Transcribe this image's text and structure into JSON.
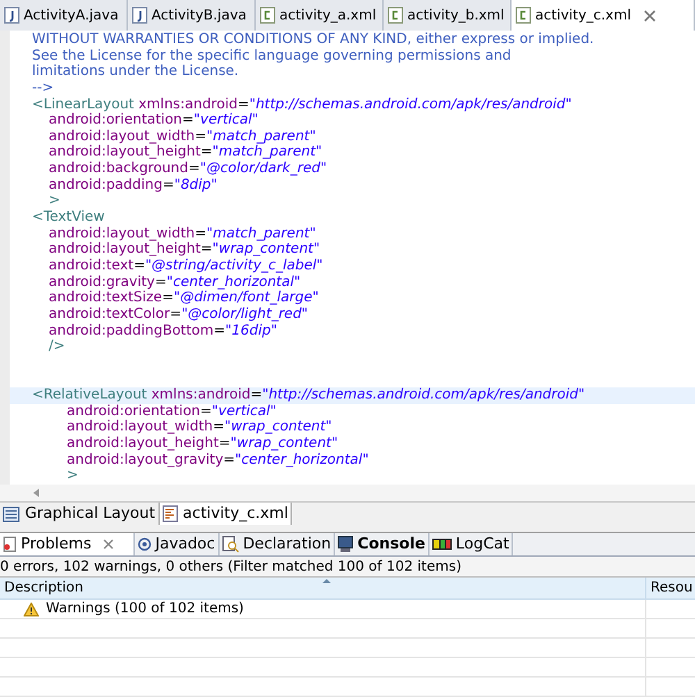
{
  "editor_tabs": [
    {
      "label": "ActivityA.java",
      "kind": "java",
      "selected": false
    },
    {
      "label": "ActivityB.java",
      "kind": "java",
      "selected": false
    },
    {
      "label": "activity_a.xml",
      "kind": "xml",
      "selected": false
    },
    {
      "label": "activity_b.xml",
      "kind": "xml",
      "selected": false
    },
    {
      "label": "activity_c.xml",
      "kind": "xml",
      "selected": true
    }
  ],
  "code_lines": [
    {
      "kind": "top",
      "current": false,
      "parts": [
        {
          "kind": "comment",
          "text": "WITHOUT WARRANTIES OR CONDITIONS OF ANY KIND, either express or implied."
        }
      ]
    },
    {
      "kind": "top",
      "current": false,
      "parts": [
        {
          "kind": "comment",
          "text": "See the License for the specific language governing permissions and"
        }
      ]
    },
    {
      "kind": "top",
      "current": false,
      "parts": [
        {
          "kind": "comment",
          "text": "limitations under the License."
        }
      ]
    },
    {
      "kind": "top",
      "current": false,
      "parts": [
        {
          "kind": "comment",
          "text": "-->"
        }
      ]
    },
    {
      "kind": "top",
      "current": false,
      "parts": [
        {
          "kind": "tag",
          "text": "<LinearLayout"
        },
        {
          "kind": "attr",
          "text": "xmlns:android"
        },
        {
          "kind": "punct",
          "text": "="
        },
        {
          "kind": "value",
          "text": "\"http://schemas.android.com/apk/res/android\""
        }
      ]
    },
    {
      "kind": "attribute",
      "current": false,
      "parts": [
        {
          "kind": "attr",
          "text": "android:orientation"
        },
        {
          "kind": "punct",
          "text": "="
        },
        {
          "kind": "value",
          "text": "\"vertical\""
        }
      ]
    },
    {
      "kind": "attribute",
      "current": false,
      "parts": [
        {
          "kind": "attr",
          "text": "android:layout_width"
        },
        {
          "kind": "punct",
          "text": "="
        },
        {
          "kind": "value",
          "text": "\"match_parent\""
        }
      ]
    },
    {
      "kind": "attribute",
      "current": false,
      "parts": [
        {
          "kind": "attr",
          "text": "android:layout_height"
        },
        {
          "kind": "punct",
          "text": "="
        },
        {
          "kind": "value",
          "text": "\"match_parent\""
        }
      ]
    },
    {
      "kind": "attribute",
      "current": false,
      "parts": [
        {
          "kind": "attr",
          "text": "android:background"
        },
        {
          "kind": "punct",
          "text": "="
        },
        {
          "kind": "value",
          "text": "\"@color/dark_red\""
        }
      ]
    },
    {
      "kind": "attribute",
      "current": false,
      "parts": [
        {
          "kind": "attr",
          "text": "android:padding"
        },
        {
          "kind": "punct",
          "text": "="
        },
        {
          "kind": "value",
          "text": "\"8dip\""
        }
      ]
    },
    {
      "kind": "attribute",
      "current": false,
      "parts": [
        {
          "kind": "tag",
          "text": ">"
        }
      ]
    },
    {
      "kind": "top",
      "current": false,
      "parts": [
        {
          "kind": "tag",
          "text": "<TextView"
        }
      ]
    },
    {
      "kind": "attribute",
      "current": false,
      "parts": [
        {
          "kind": "attr",
          "text": "android:layout_width"
        },
        {
          "kind": "punct",
          "text": "="
        },
        {
          "kind": "value",
          "text": "\"match_parent\""
        }
      ]
    },
    {
      "kind": "attribute",
      "current": false,
      "parts": [
        {
          "kind": "attr",
          "text": "android:layout_height"
        },
        {
          "kind": "punct",
          "text": "="
        },
        {
          "kind": "value",
          "text": "\"wrap_content\""
        }
      ]
    },
    {
      "kind": "attribute",
      "current": false,
      "parts": [
        {
          "kind": "attr",
          "text": "android:text"
        },
        {
          "kind": "punct",
          "text": "="
        },
        {
          "kind": "value",
          "text": "\"@string/activity_c_label\""
        }
      ]
    },
    {
      "kind": "attribute",
      "current": false,
      "parts": [
        {
          "kind": "attr",
          "text": "android:gravity"
        },
        {
          "kind": "punct",
          "text": "="
        },
        {
          "kind": "value",
          "text": "\"center_horizontal\""
        }
      ]
    },
    {
      "kind": "attribute",
      "current": false,
      "parts": [
        {
          "kind": "attr",
          "text": "android:textSize"
        },
        {
          "kind": "punct",
          "text": "="
        },
        {
          "kind": "value",
          "text": "\"@dimen/font_large\""
        }
      ]
    },
    {
      "kind": "attribute",
      "current": false,
      "parts": [
        {
          "kind": "attr",
          "text": "android:textColor"
        },
        {
          "kind": "punct",
          "text": "="
        },
        {
          "kind": "value",
          "text": "\"@color/light_red\""
        }
      ]
    },
    {
      "kind": "attribute",
      "current": false,
      "parts": [
        {
          "kind": "attr",
          "text": "android:paddingBottom"
        },
        {
          "kind": "punct",
          "text": "="
        },
        {
          "kind": "value",
          "text": "\"16dip\""
        }
      ]
    },
    {
      "kind": "attribute",
      "current": false,
      "parts": [
        {
          "kind": "tag",
          "text": "/>"
        }
      ]
    },
    {
      "kind": "blank",
      "current": false
    },
    {
      "kind": "blank",
      "current": false
    },
    {
      "kind": "top",
      "current": true,
      "parts": [
        {
          "kind": "tag",
          "text": "<RelativeLayout"
        },
        {
          "kind": "attr",
          "text": "xmlns:android"
        },
        {
          "kind": "punct",
          "text": "="
        },
        {
          "kind": "value",
          "text": "\"http://schemas.android.com/apk/res/android\""
        }
      ]
    },
    {
      "kind": "nested",
      "current": false,
      "parts": [
        {
          "kind": "attr",
          "text": "android:orientation"
        },
        {
          "kind": "punct",
          "text": "="
        },
        {
          "kind": "value",
          "text": "\"vertical\""
        }
      ]
    },
    {
      "kind": "nested",
      "current": false,
      "parts": [
        {
          "kind": "attr",
          "text": "android:layout_width"
        },
        {
          "kind": "punct",
          "text": "="
        },
        {
          "kind": "value",
          "text": "\"wrap_content\""
        }
      ]
    },
    {
      "kind": "nested",
      "current": false,
      "parts": [
        {
          "kind": "attr",
          "text": "android:layout_height"
        },
        {
          "kind": "punct",
          "text": "="
        },
        {
          "kind": "value",
          "text": "\"wrap_content\""
        }
      ]
    },
    {
      "kind": "nested",
      "current": false,
      "parts": [
        {
          "kind": "attr",
          "text": "android:layout_gravity"
        },
        {
          "kind": "punct",
          "text": "="
        },
        {
          "kind": "value",
          "text": "\"center_horizontal\""
        }
      ]
    },
    {
      "kind": "nested",
      "current": false,
      "parts": [
        {
          "kind": "tag",
          "text": ">"
        }
      ]
    }
  ],
  "editor_mode_tabs": [
    {
      "label": "Graphical Layout",
      "kind": "layout",
      "selected": false
    },
    {
      "label": "activity_c.xml",
      "kind": "source",
      "selected": true
    }
  ],
  "view_tabs": [
    {
      "label": "Problems",
      "kind": "problems",
      "selected": true
    },
    {
      "label": "Javadoc",
      "kind": "javadoc",
      "selected": false
    },
    {
      "label": "Declaration",
      "kind": "declaration",
      "selected": false
    },
    {
      "label": "Console",
      "kind": "console",
      "selected": false
    },
    {
      "label": "LogCat",
      "kind": "logcat",
      "selected": false
    }
  ],
  "problems": {
    "summary": "0 errors, 102 warnings, 0 others (Filter matched 100 of 102 items)",
    "columns": [
      "Description",
      "Resou"
    ],
    "rows": [
      {
        "kind": "warning",
        "description": "Warnings (100 of 102 items)"
      }
    ]
  }
}
